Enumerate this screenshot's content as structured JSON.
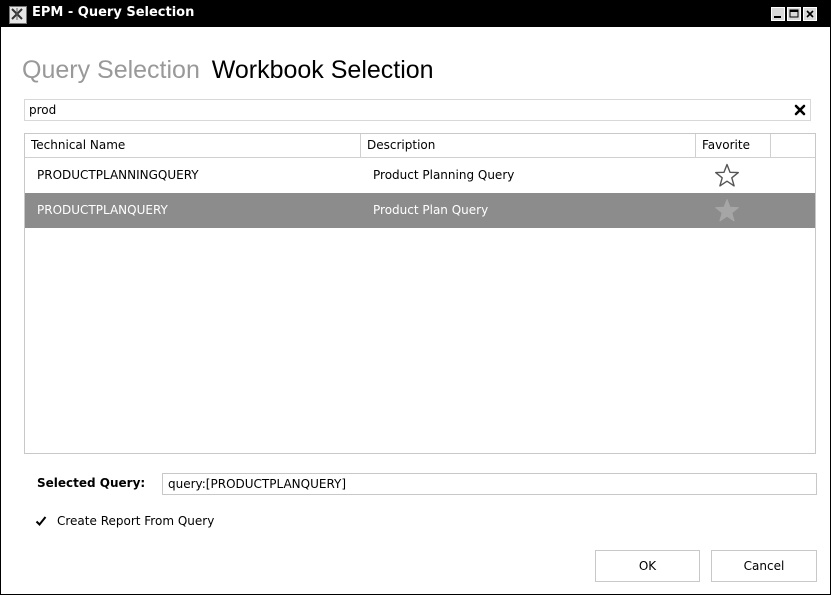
{
  "window": {
    "title": "EPM - Query Selection",
    "icon": "epm-app-icon"
  },
  "tabs": [
    {
      "label": "Query Selection",
      "active": false
    },
    {
      "label": "Workbook Selection",
      "active": true
    }
  ],
  "search": {
    "value": "prod",
    "clear_icon": "close-x-icon"
  },
  "grid": {
    "columns": [
      "Technical Name",
      "Description",
      "Favorite",
      ""
    ],
    "rows": [
      {
        "technical_name": "PRODUCTPLANNINGQUERY",
        "description": "Product Planning Query",
        "favorite": false,
        "selected": false
      },
      {
        "technical_name": "PRODUCTPLANQUERY",
        "description": "Product Plan Query",
        "favorite": false,
        "selected": true
      }
    ]
  },
  "selected_query": {
    "label": "Selected Query:",
    "value": "query:[PRODUCTPLANQUERY]"
  },
  "create_report": {
    "label": "Create Report From Query",
    "checked": true
  },
  "buttons": {
    "ok": "OK",
    "cancel": "Cancel"
  },
  "colors": {
    "titlebar": "#000000",
    "selected_row": "#8c8c8c",
    "inactive_tab": "#999999"
  }
}
